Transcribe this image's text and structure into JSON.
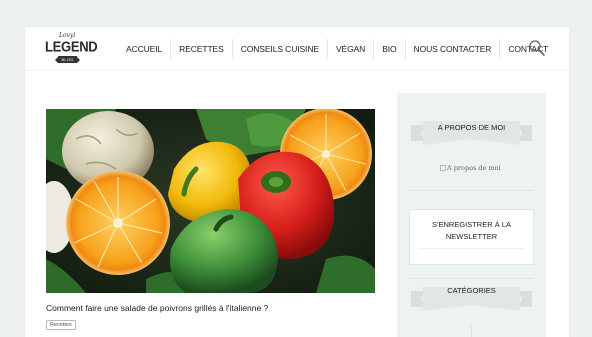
{
  "logo": {
    "script": "Lovyi",
    "word": "LEGEND",
    "ribbon": "BLOG"
  },
  "nav": {
    "items": [
      {
        "label": "Accueil"
      },
      {
        "label": "Recettes"
      },
      {
        "label": "Conseils Cuisine"
      },
      {
        "label": "Végan"
      },
      {
        "label": "Bio"
      },
      {
        "label": "Nous contacter"
      },
      {
        "label": "Contact"
      }
    ]
  },
  "post": {
    "title": "Comment faire une salade de poivrons grillés à l'italienne ?",
    "tag": "Recettes"
  },
  "sidebar": {
    "about": {
      "title": "A propos de moi",
      "image_alt": "A propos de moi"
    },
    "newsletter": {
      "title": "S'enregistrer à la newsletter"
    },
    "categories": {
      "title": "Catégories"
    }
  },
  "colors": {
    "background": "#eef1f1",
    "sidebar": "#edf2f2",
    "ribbon": "#d9dede"
  }
}
